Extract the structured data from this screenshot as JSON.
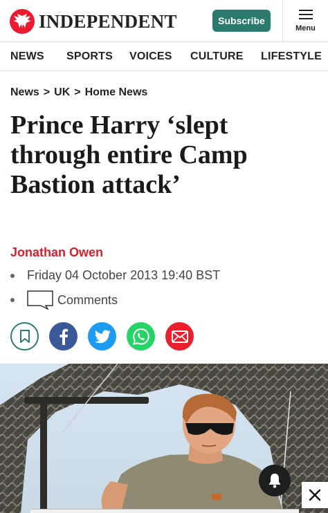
{
  "header": {
    "logo_text": "INDEPENDENT",
    "subscribe_label": "Subscribe",
    "menu_label": "Menu"
  },
  "nav": {
    "items": [
      "NEWS",
      "SPORTS",
      "VOICES",
      "CULTURE",
      "LIFESTYLE"
    ]
  },
  "breadcrumb": {
    "items": [
      "News",
      "UK",
      "Home News"
    ],
    "separator": ">"
  },
  "article": {
    "headline_lines": [
      "Prince Harry ‘slept",
      "through entire Camp",
      "Bastion attack’"
    ],
    "author": "Jonathan Owen",
    "date": "Friday 04 October 2013 19:40 BST",
    "comments_label": "Comments"
  },
  "share": {
    "buttons": [
      "bookmark-icon",
      "facebook-icon",
      "twitter-icon",
      "whatsapp-icon",
      "email-icon"
    ]
  },
  "colors": {
    "brand_red": "#ec1a2e",
    "author_red": "#d81e2e",
    "subscribe_green": "#2a7a6e",
    "facebook": "#3b5998",
    "twitter": "#1d9bf0",
    "whatsapp": "#25d366",
    "email": "#e8202e",
    "bookmark": "#2a7a6e"
  }
}
